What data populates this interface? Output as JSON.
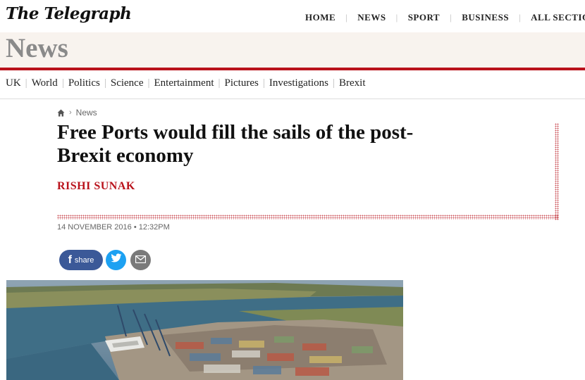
{
  "header": {
    "logo": "The Telegraph",
    "nav": [
      "HOME",
      "NEWS",
      "SPORT",
      "BUSINESS",
      "ALL SECTION"
    ]
  },
  "section": {
    "title": "News",
    "subnav": [
      "UK",
      "World",
      "Politics",
      "Science",
      "Entertainment",
      "Pictures",
      "Investigations",
      "Brexit"
    ]
  },
  "article": {
    "breadcrumb": "News",
    "headline": "Free Ports would fill the sails of the post-Brexit economy",
    "author": "RISHI SUNAK",
    "dateline": "14 NOVEMBER 2016 • 12:32PM",
    "share_label": "share"
  },
  "colors": {
    "brand_red": "#b9121b",
    "facebook": "#3b5998",
    "twitter": "#1da1f2",
    "email": "#7a7a7a"
  },
  "icons": [
    "home-icon",
    "facebook-icon",
    "twitter-icon",
    "email-icon"
  ]
}
